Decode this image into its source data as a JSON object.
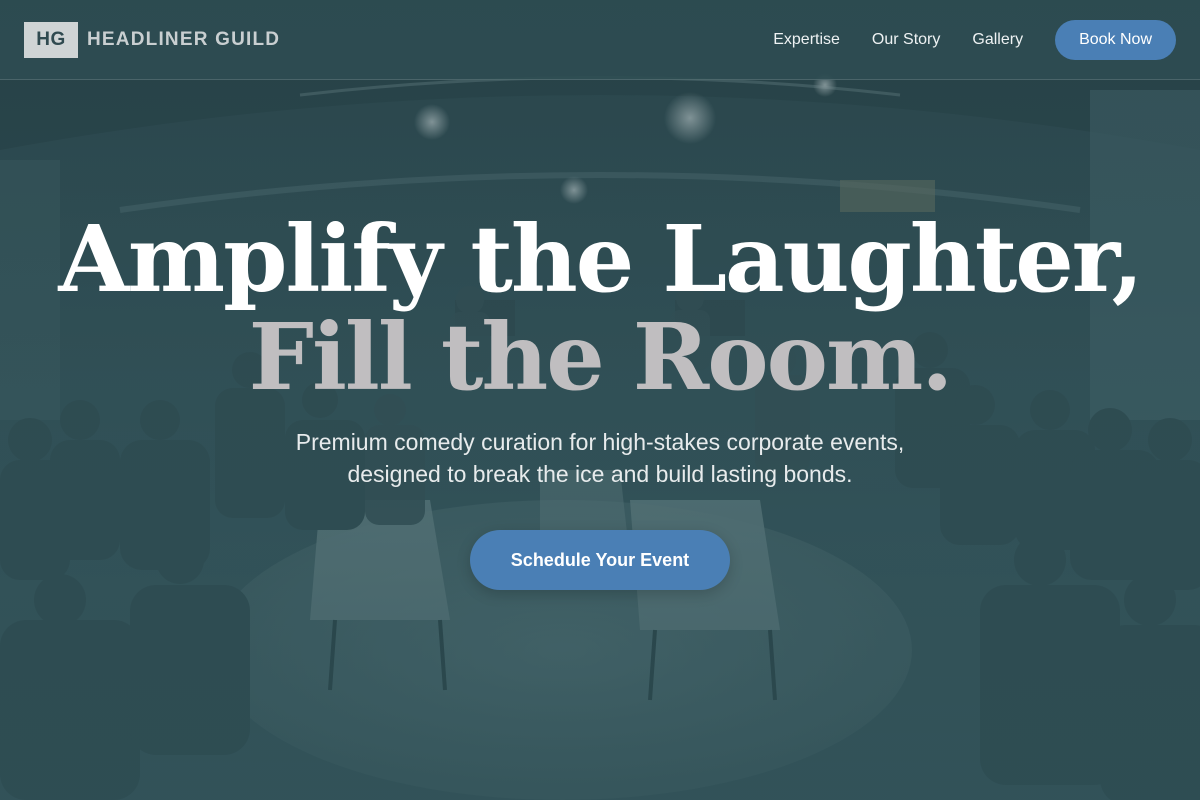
{
  "header": {
    "brand_badge": "HG",
    "brand_name": "HEADLINER GUILD",
    "nav": [
      {
        "label": "Expertise"
      },
      {
        "label": "Our Story"
      },
      {
        "label": "Gallery"
      }
    ],
    "cta_label": "Book Now"
  },
  "hero": {
    "headline_line1": "Amplify the Laughter,",
    "headline_line2": "Fill the Room.",
    "subtitle_line1": "Premium comedy curation for high-stakes corporate events,",
    "subtitle_line2": "designed to break the ice and build lasting bonds.",
    "cta_label": "Schedule Your Event"
  },
  "colors": {
    "accent": "#4a7fb5",
    "header_bg": "#2e4c52",
    "headline_primary": "#ffffff",
    "headline_secondary": "#c0bec0"
  },
  "icons": []
}
